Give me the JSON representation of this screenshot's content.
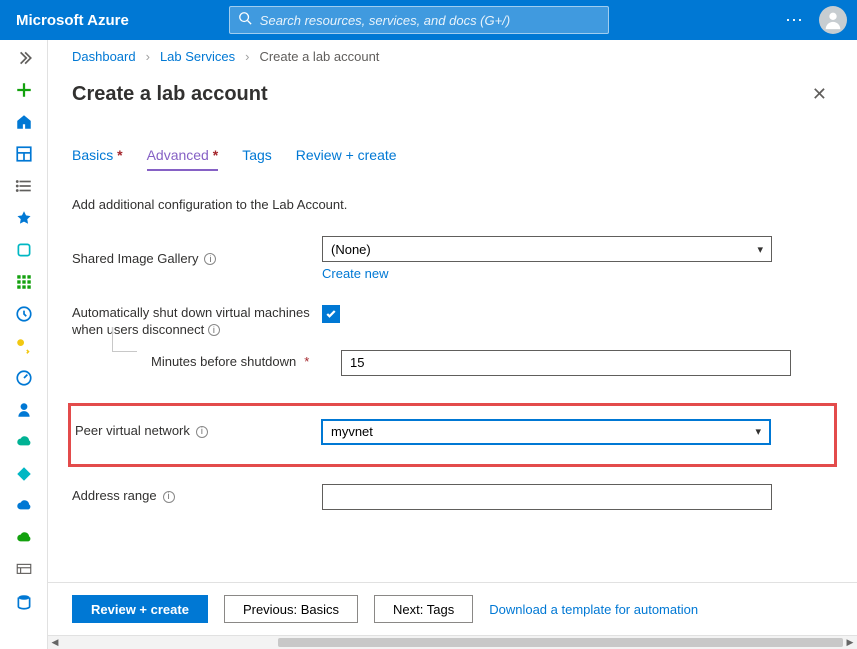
{
  "header": {
    "brand": "Microsoft Azure",
    "search_placeholder": "Search resources, services, and docs (G+/)"
  },
  "breadcrumb": {
    "items": [
      "Dashboard",
      "Lab Services"
    ],
    "current": "Create a lab account"
  },
  "page": {
    "title": "Create a lab account"
  },
  "tabs": {
    "basics": "Basics",
    "advanced": "Advanced",
    "tags": "Tags",
    "review": "Review + create"
  },
  "form": {
    "intro": "Add additional configuration to the Lab Account.",
    "shared_image_gallery": {
      "label": "Shared Image Gallery",
      "value": "(None)",
      "create_new": "Create new"
    },
    "auto_shutdown": {
      "label": "Automatically shut down virtual machines when users disconnect",
      "checked": true,
      "minutes_label": "Minutes before shutdown",
      "minutes_value": "15"
    },
    "peer_vnet": {
      "label": "Peer virtual network",
      "value": "myvnet"
    },
    "address_range": {
      "label": "Address range",
      "value": ""
    }
  },
  "footer": {
    "review": "Review + create",
    "previous": "Previous: Basics",
    "next": "Next: Tags",
    "download": "Download a template for automation"
  }
}
